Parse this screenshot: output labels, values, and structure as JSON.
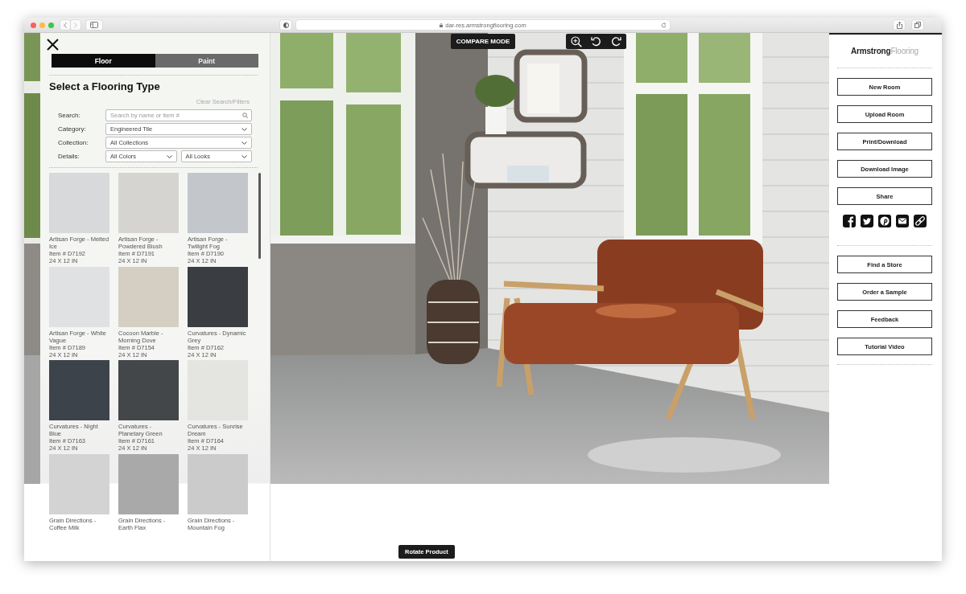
{
  "browser": {
    "url": "dar-res.armstrongflooring.com"
  },
  "panel": {
    "tabs": [
      {
        "label": "Floor",
        "selected": true
      },
      {
        "label": "Paint",
        "selected": false
      }
    ],
    "title": "Select a Flooring Type",
    "clear_link": "Clear Search/Filters",
    "filters": [
      {
        "kind": "search",
        "label": "Search:",
        "fields": [
          {
            "placeholder": "Search by name or item #"
          }
        ]
      },
      {
        "kind": "select",
        "label": "Category:",
        "fields": [
          {
            "value": "Engineered Tile"
          }
        ]
      },
      {
        "kind": "select",
        "label": "Collection:",
        "fields": [
          {
            "value": "All Collections"
          }
        ]
      },
      {
        "kind": "select",
        "label": "Details:",
        "fields": [
          {
            "value": "All Colors"
          },
          {
            "value": "All Looks"
          }
        ]
      }
    ],
    "products": [
      {
        "name": "Artisan Forge - Melted Ice",
        "item": "Item # D7192",
        "size": "24 X 12 IN",
        "color": "#d8d9da"
      },
      {
        "name": "Artisan Forge - Powdered Blush",
        "item": "Item # D7191",
        "size": "24 X 12 IN",
        "color": "#d6d4d0"
      },
      {
        "name": "Artisan Forge - Twilight Fog",
        "item": "Item # D7190",
        "size": "24 X 12 IN",
        "color": "#c3c6cb"
      },
      {
        "name": "Artisan Forge - White Vague",
        "item": "Item # D7189",
        "size": "24 X 12 IN",
        "color": "#dfe1e2"
      },
      {
        "name": "Cocoon Marble - Morning Dove",
        "item": "Item # D7154",
        "size": "24 X 12 IN",
        "color": "#d5cfc3"
      },
      {
        "name": "Curvatures - Dynamic Grey",
        "item": "Item # D7162",
        "size": "24 X 12 IN",
        "color": "#3a3d41"
      },
      {
        "name": "Curvatures - Night Blue",
        "item": "Item # D7163",
        "size": "24 X 12 IN",
        "color": "#3d434b"
      },
      {
        "name": "Curvatures - Planetary Green",
        "item": "Item # D7161",
        "size": "24 X 12 IN",
        "color": "#43474a"
      },
      {
        "name": "Curvatures - Sunrise Dream",
        "item": "Item # D7164",
        "size": "24 X 12 IN",
        "color": "#e4e4e1"
      },
      {
        "name": "Grain Directions - Coffee Milk",
        "color": "#d3d3d3"
      },
      {
        "name": "Grain Directions - Earth Flax",
        "color": "#a9a9a9"
      },
      {
        "name": "Grain Directions - Mountain Fog",
        "color": "#cbcbcb"
      }
    ]
  },
  "viewer": {
    "compare_button": "COMPARE MODE",
    "rotate_button": "Rotate Product"
  },
  "sidebar": {
    "logo": "**Armstrong**Flooring",
    "actions": [
      "New Room",
      "Upload Room",
      "Print/Download",
      "Download Image",
      "Share"
    ],
    "links": [
      "Find a Store",
      "Order a Sample",
      "Feedback",
      "Tutorial Video"
    ]
  }
}
